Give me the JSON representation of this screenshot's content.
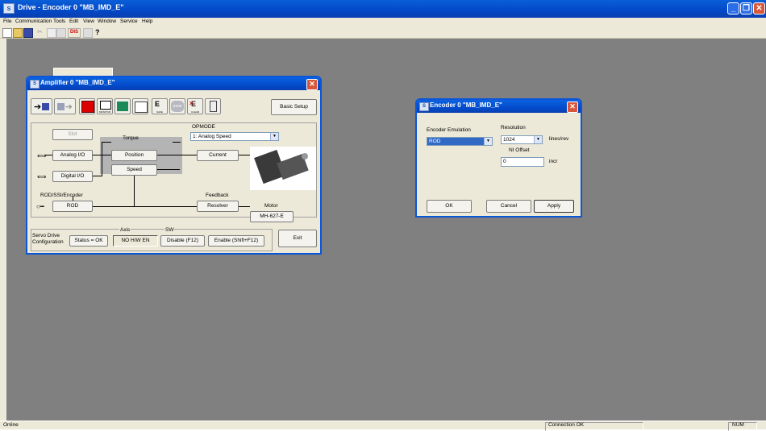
{
  "app": {
    "title": "Drive - Encoder 0 \"MB_IMD_E\"",
    "icon_text": "S"
  },
  "menu": [
    "File",
    "Communication",
    "Tools",
    "Edit",
    "View",
    "Window",
    "Service",
    "Help"
  ],
  "toolbar": {
    "dis_label": "DIS"
  },
  "status": {
    "left": "Online",
    "connection": "Connection OK",
    "num": "NUM"
  },
  "amplifier": {
    "title": "Amplifier 0 \"MB_IMD_E\"",
    "basic_setup": "Basic Setup",
    "icon_labels": {
      "monitor": "MONITOR",
      "save": "SAVE",
      "stop": "STOP",
      "clear": "CLEAR"
    },
    "slot": "Slot",
    "torque": "Torque",
    "opmode_label": "OPMODE",
    "opmode_value": "1: Analog Speed",
    "analog_io": "Analog I/O",
    "position": "Position",
    "current": "Current",
    "speed": "Speed",
    "digital_io": "Digital I/O",
    "rod_ssi_label": "ROD/SSI/Encoder",
    "feedback_label": "Feedback",
    "motor_label": "Motor",
    "rod": "ROD",
    "resolver": "Resolver",
    "motor_model": "MH-627-E",
    "servo_config": "Servo Drive Configuration",
    "status_ok": "Status = OK",
    "axis_label": "Axis",
    "axis_value": "NO H/W EN",
    "sw_label": "SW",
    "disable": "Disable (F12)",
    "enable": "Enable (Shift+F12)",
    "exit": "Exit"
  },
  "encoder": {
    "title": "Encoder 0 \"MB_IMD_E\"",
    "emulation_label": "Encoder Emulation",
    "emulation_value": "ROD",
    "resolution_label": "Resolution",
    "resolution_value": "1024",
    "resolution_unit": "lines/rev",
    "ni_offset_label": "NI Offset",
    "ni_offset_value": "0",
    "ni_offset_unit": "incr",
    "ok": "OK",
    "cancel": "Cancel",
    "apply": "Apply"
  },
  "colors": {
    "titlebar": "#0348c7",
    "mdi_background": "#808080",
    "selection": "#316ac5",
    "close": "#d8573a"
  }
}
